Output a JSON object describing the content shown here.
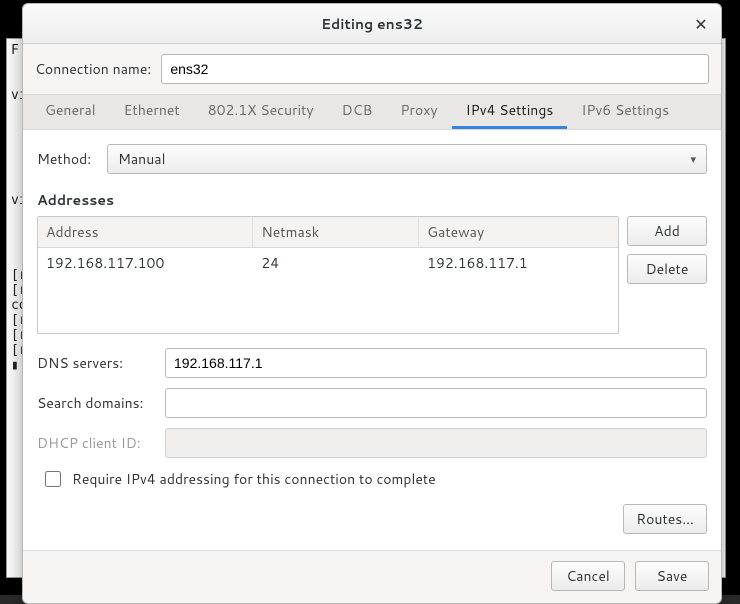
{
  "window": {
    "title": "Editing ens32"
  },
  "connection": {
    "label": "Connection name:",
    "value": "ens32"
  },
  "tabs": {
    "general": "General",
    "ethernet": "Ethernet",
    "security": "802.1X Security",
    "dcb": "DCB",
    "proxy": "Proxy",
    "ipv4": "IPv4 Settings",
    "ipv6": "IPv6 Settings"
  },
  "method": {
    "label": "Method:",
    "value": "Manual"
  },
  "addresses": {
    "title": "Addresses",
    "headers": {
      "address": "Address",
      "netmask": "Netmask",
      "gateway": "Gateway"
    },
    "rows": [
      {
        "address": "192.168.117.100",
        "netmask": "24",
        "gateway": "192.168.117.1"
      }
    ],
    "add": "Add",
    "delete": "Delete"
  },
  "dns": {
    "label": "DNS servers:",
    "value": "192.168.117.1"
  },
  "search": {
    "label": "Search domains:",
    "value": ""
  },
  "dhcp": {
    "label": "DHCP client ID:",
    "value": ""
  },
  "require_ipv4": {
    "label": "Require IPv4 addressing for this connection to complete",
    "checked": false
  },
  "routes": {
    "label": "Routes…"
  },
  "footer": {
    "cancel": "Cancel",
    "save": "Save"
  },
  "background_text": "F\n\n\nvi\n\n\n\n\n\n\nvi\n\n\n\n\n[r\n[r\nco\n[r\n[r\n[r\n▮"
}
